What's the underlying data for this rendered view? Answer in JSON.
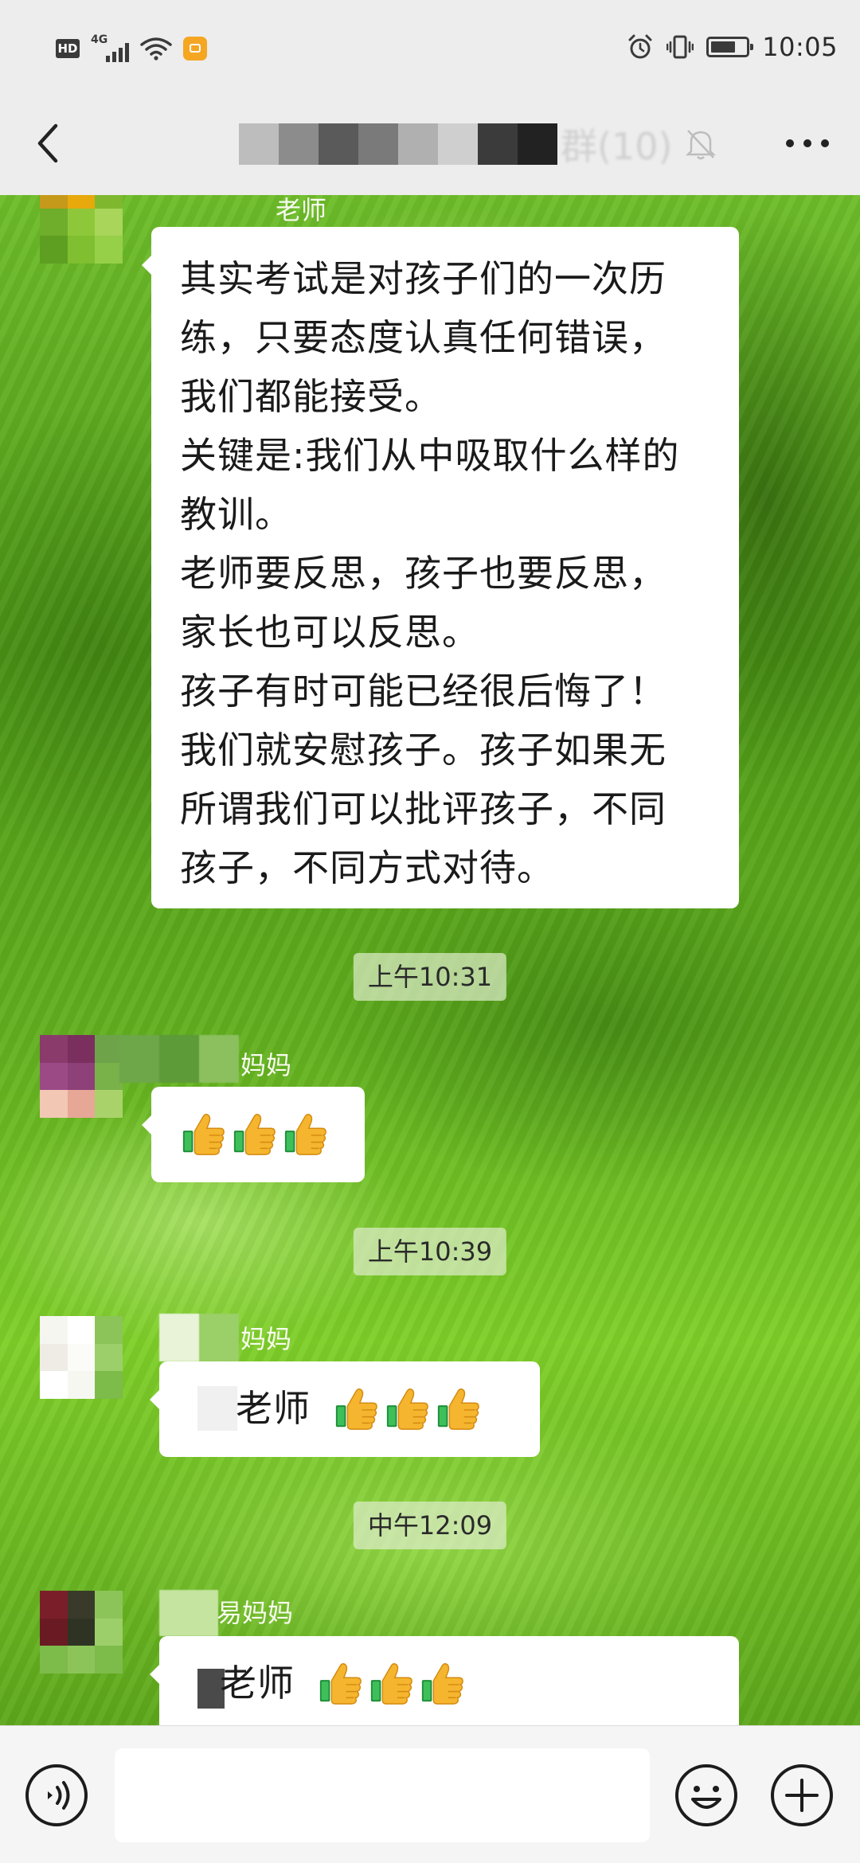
{
  "status_bar": {
    "hd_label": "HD",
    "network_label": "4G",
    "time": "10:05"
  },
  "header": {
    "title_suffix": "群(10)",
    "back_icon": "chevron-left-icon",
    "mute_icon": "bell-muted-icon",
    "more_icon": "more-dots-icon"
  },
  "messages": [
    {
      "sender_suffix": "老师",
      "lines": [
        "其实考试是对孩子们的一次历",
        "练，只要态度认真任何错误，",
        "我们都能接受。",
        "关键是:我们从中吸取什么样的",
        "教训。",
        "老师要反思，孩子也要反思，",
        "家长也可以反思。",
        "孩子有时可能已经很后悔了！",
        "我们就安慰孩子。孩子如果无",
        "所谓我们可以批评孩子，不同",
        "孩子，不同方式对待。"
      ]
    },
    {
      "time": "上午10:31",
      "sender_suffix": "妈妈",
      "emoji": "thumbs-up-icon",
      "emoji_count": 3
    },
    {
      "time": "上午10:39",
      "sender_suffix": "妈妈",
      "text": "老师",
      "emoji": "thumbs-up-icon",
      "emoji_count": 3
    },
    {
      "time": "中午12:09",
      "sender_suffix": "易妈妈",
      "text": "老师",
      "emoji": "thumbs-up-icon",
      "emoji_count": 3
    }
  ],
  "input_bar": {
    "message_value": "",
    "voice_icon": "voice-icon",
    "emoji_icon": "emoji-icon",
    "add_icon": "plus-circle-icon"
  },
  "colors": {
    "bar_background": "#ededed",
    "bubble_background": "#ffffff",
    "chat_wallpaper": "#5ea81c",
    "time_chip_background": "#dcebc8"
  }
}
